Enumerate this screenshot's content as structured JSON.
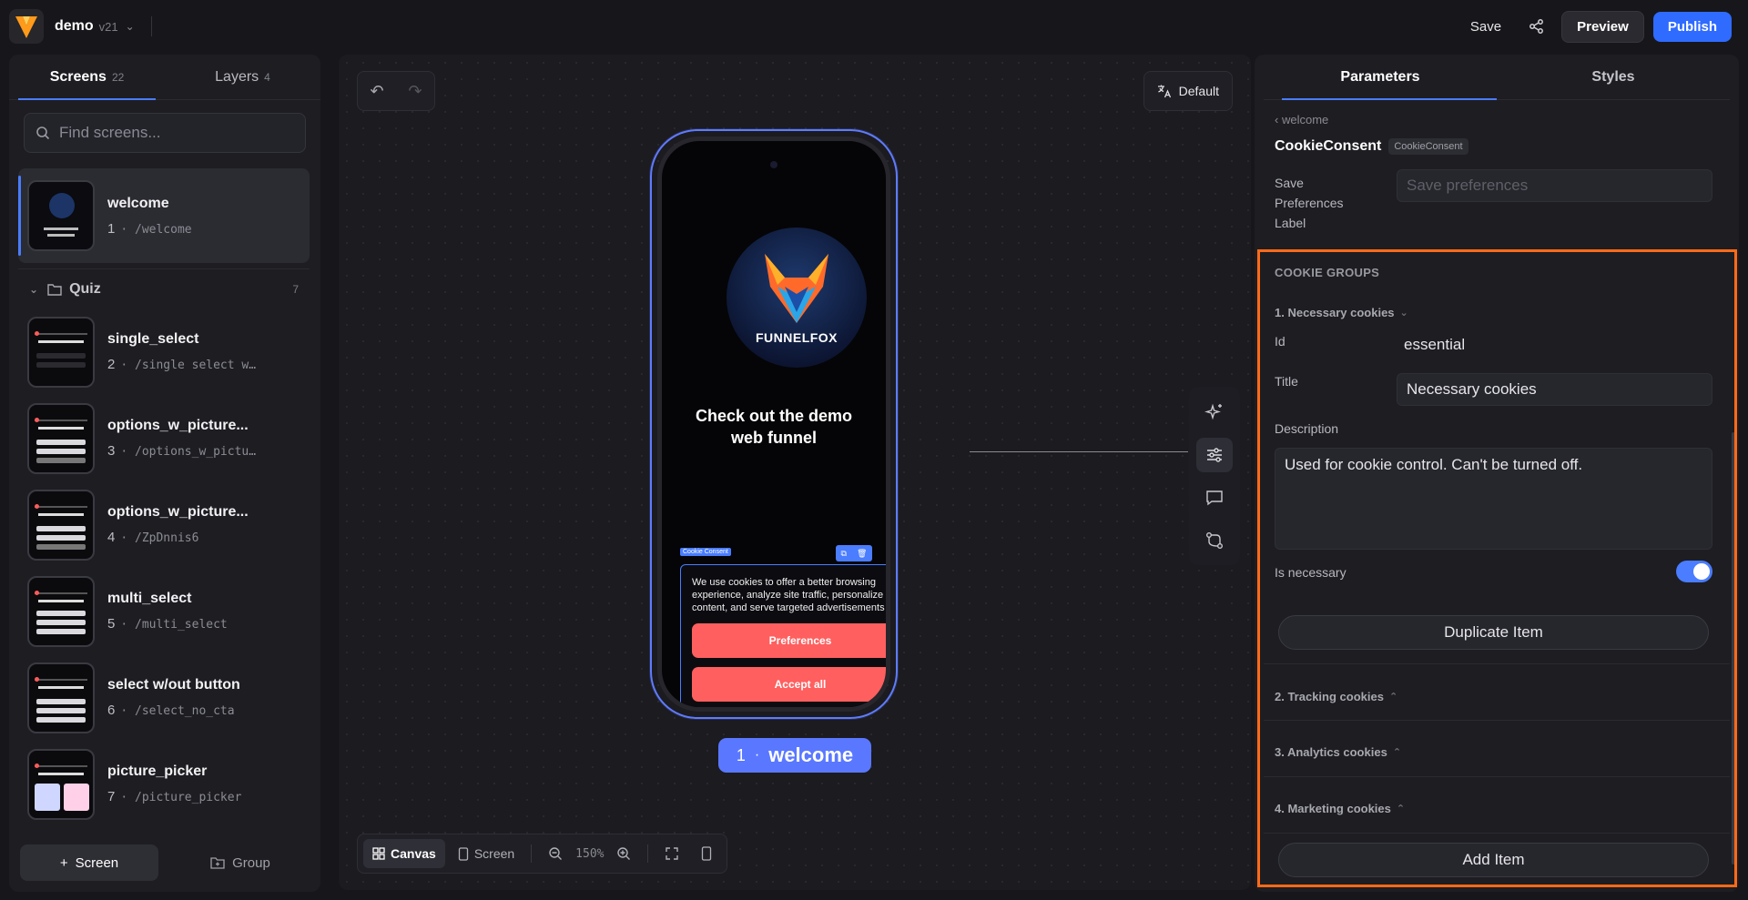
{
  "header": {
    "project_name": "demo",
    "version": "v21",
    "save_label": "Save",
    "preview_label": "Preview",
    "publish_label": "Publish"
  },
  "left_panel": {
    "tabs": [
      {
        "label": "Screens",
        "count": "22"
      },
      {
        "label": "Layers",
        "count": "4"
      }
    ],
    "search_placeholder": "Find screens...",
    "welcome": {
      "name": "welcome",
      "index": "1",
      "path": "/welcome"
    },
    "group": {
      "name": "Quiz",
      "count": "7"
    },
    "screens": [
      {
        "name": "single_select",
        "index": "2",
        "path": "/single select w…"
      },
      {
        "name": "options_w_picture...",
        "index": "3",
        "path": "/options_w_pictu…"
      },
      {
        "name": "options_w_picture...",
        "index": "4",
        "path": "/ZpDnnis6"
      },
      {
        "name": "multi_select",
        "index": "5",
        "path": "/multi_select"
      },
      {
        "name": "select w/out button",
        "index": "6",
        "path": "/select_no_cta"
      },
      {
        "name": "picture_picker",
        "index": "7",
        "path": "/picture_picker"
      }
    ],
    "add_screen_label": "Screen",
    "add_group_label": "Group"
  },
  "canvas": {
    "locale_label": "Default",
    "phone": {
      "brand": "FUNNELFOX",
      "headline_line1": "Check out the demo",
      "headline_line2": "web funnel",
      "component_tag": "Cookie Consent",
      "cookie_text": "We use cookies to offer a better browsing experience, analyze site traffic, personalize content, and serve targeted advertisements",
      "preferences_label": "Preferences",
      "accept_label": "Accept all"
    },
    "screen_label": {
      "index": "1",
      "name": "welcome"
    },
    "toolbar": {
      "canvas_label": "Canvas",
      "screen_label": "Screen",
      "zoom": "150%"
    }
  },
  "right_panel": {
    "tabs": [
      "Parameters",
      "Styles"
    ],
    "breadcrumb": "welcome",
    "component_name": "CookieConsent",
    "component_chip": "CookieConsent",
    "save_pref_label_l1": "Save",
    "save_pref_label_l2": "Preferences",
    "save_pref_label_l3": "Label",
    "save_pref_placeholder": "Save preferences",
    "section_title": "COOKIE GROUPS",
    "items": [
      {
        "heading": "1. Necessary cookies"
      },
      {
        "heading": "2. Tracking cookies"
      },
      {
        "heading": "3. Analytics cookies"
      },
      {
        "heading": "4. Marketing cookies"
      }
    ],
    "id_label": "Id",
    "id_value": "essential",
    "title_label": "Title",
    "title_value": "Necessary cookies",
    "description_label": "Description",
    "description_value": "Used for cookie control. Can't be turned off.",
    "is_necessary_label": "Is necessary",
    "is_necessary": true,
    "duplicate_label": "Duplicate Item",
    "add_item_label": "Add Item"
  },
  "colors": {
    "accent": "#4a7dff",
    "publish": "#2f6bff",
    "cta": "#ff5f5f",
    "highlight": "#ff6a18"
  }
}
